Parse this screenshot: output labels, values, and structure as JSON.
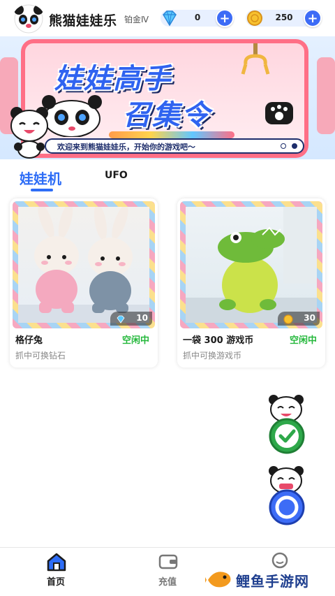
{
  "header": {
    "app_name": "熊猫娃娃乐",
    "rank": "铂金Ⅳ",
    "diamonds": "0",
    "coins": "250",
    "plus_label": "+"
  },
  "banner": {
    "title_line1": "娃娃高手",
    "title_line2": "召集令",
    "marquee": "欢迎来到熊猫娃娃乐，开始你的游戏吧～"
  },
  "tabs": [
    {
      "label": "娃娃机",
      "active": true
    },
    {
      "label": "UFO",
      "active": false
    }
  ],
  "machines": [
    {
      "name": "格仔兔",
      "status": "空闲中",
      "reward": "抓中可换钻石",
      "price": "10",
      "price_icon": "diamond-icon"
    },
    {
      "name": "一袋 300 游戏币",
      "status": "空闲中",
      "reward": "抓中可换游戏币",
      "price": "30",
      "price_icon": "coin-icon"
    }
  ],
  "bottom_nav": [
    {
      "label": "首页",
      "icon": "home-icon",
      "active": true
    },
    {
      "label": "充值",
      "icon": "wallet-icon",
      "active": false
    },
    {
      "label": "",
      "icon": "profile-icon",
      "active": false
    }
  ],
  "watermark": "鲤鱼手游网",
  "colors": {
    "accent": "#2e6df6",
    "status_idle": "#25b83c",
    "banner_frame": "#ff6f86"
  }
}
